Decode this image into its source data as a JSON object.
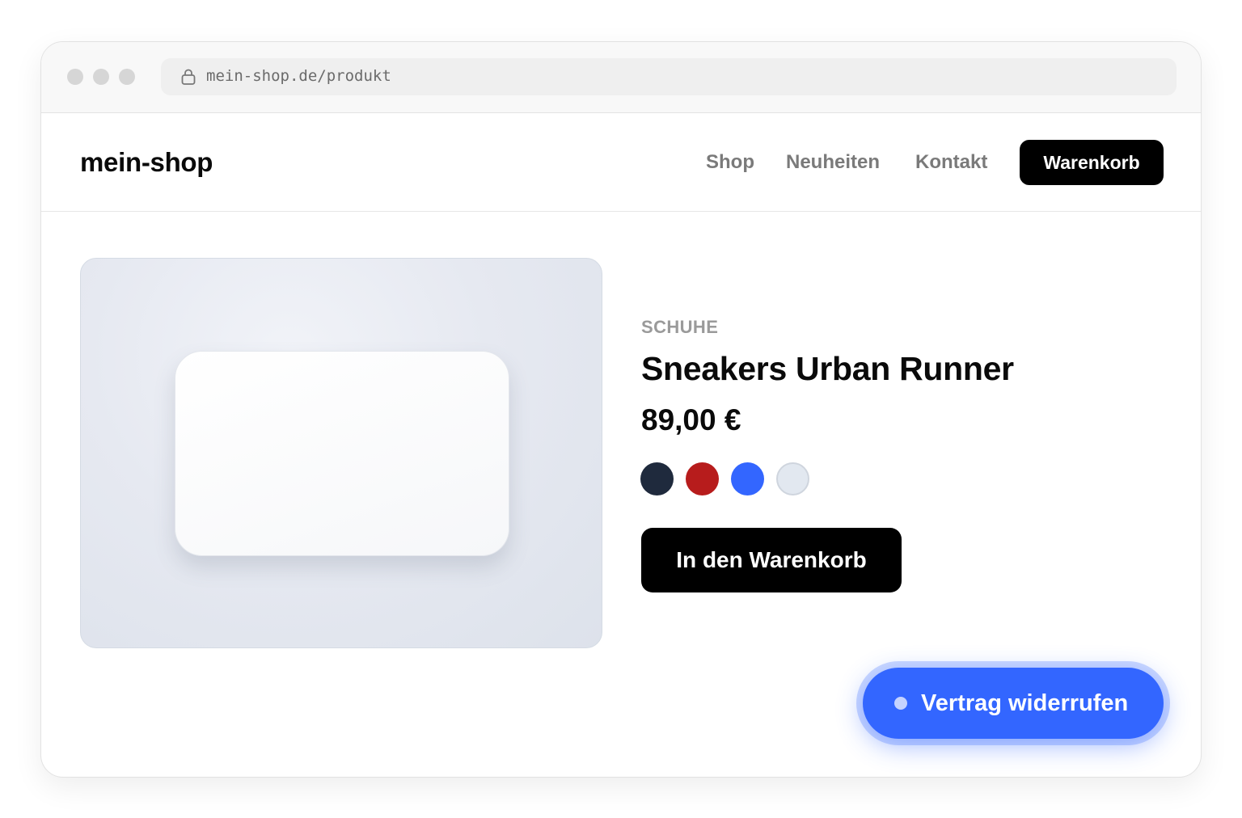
{
  "browser": {
    "url": "mein-shop.de/produkt",
    "icons": [
      "lock-icon"
    ]
  },
  "header": {
    "logo": "mein-shop",
    "nav": [
      {
        "label": "Shop"
      },
      {
        "label": "Neuheiten"
      },
      {
        "label": "Kontakt"
      }
    ],
    "cart_label": "Warenkorb"
  },
  "product": {
    "category": "SCHUHE",
    "title": "Sneakers Urban Runner",
    "price": "89,00 €",
    "colors": [
      "#1f2a3d",
      "#b71c1c",
      "#3366ff",
      "#e2e8f0"
    ],
    "add_to_cart_label": "In den Warenkorb"
  },
  "floating": {
    "withdraw_label": "Vertrag widerrufen"
  },
  "theme": {
    "accent": "#3366ff",
    "primary": "#000000"
  }
}
